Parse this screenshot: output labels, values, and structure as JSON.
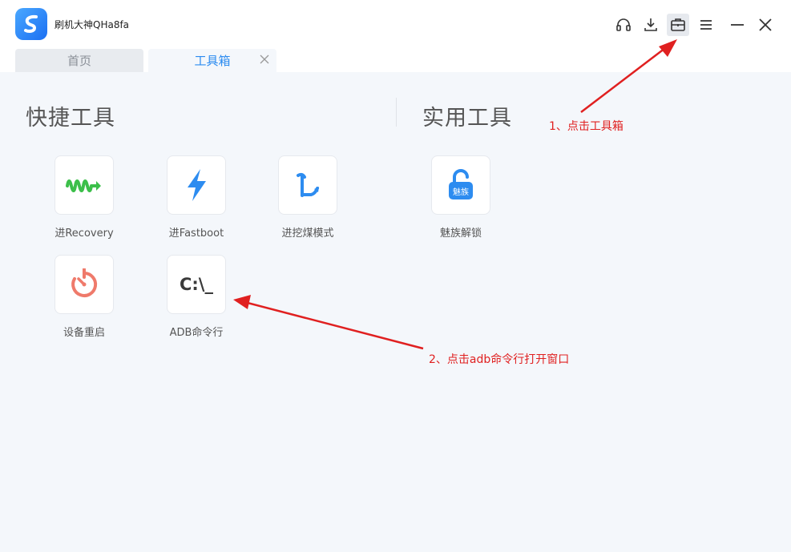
{
  "app": {
    "title": "刷机大神QHa8fa"
  },
  "window_controls": {
    "support_icon": "headset-icon",
    "download_icon": "download-icon",
    "toolbox_icon": "toolbox-icon",
    "menu_icon": "menu-icon",
    "minimize_icon": "minimize-icon",
    "close_icon": "close-icon"
  },
  "tabs": [
    {
      "label": "首页",
      "active": false
    },
    {
      "label": "工具箱",
      "active": true
    }
  ],
  "sections": {
    "quick_tools": {
      "title": "快捷工具",
      "items": [
        {
          "label": "进Recovery",
          "icon": "recovery-icon"
        },
        {
          "label": "进Fastboot",
          "icon": "lightning-icon"
        },
        {
          "label": "进挖煤模式",
          "icon": "pickaxe-icon"
        },
        {
          "label": "设备重启",
          "icon": "restart-icon"
        },
        {
          "label": "ADB命令行",
          "icon": "terminal-icon",
          "icon_text": "C:\\_"
        }
      ]
    },
    "utility_tools": {
      "title": "实用工具",
      "items": [
        {
          "label": "魅族解锁",
          "icon": "meizu-unlock-icon",
          "icon_text": "魅族"
        }
      ]
    }
  },
  "annotations": [
    {
      "text": "1、点击工具箱"
    },
    {
      "text": "2、点击adb命令行打开窗口"
    }
  ],
  "colors": {
    "accent": "#2d8cf0",
    "annotation": "#e02020",
    "recovery_green": "#3cbf4a",
    "fastboot_blue": "#2d8cf0",
    "restart_red": "#ef7a6b"
  }
}
